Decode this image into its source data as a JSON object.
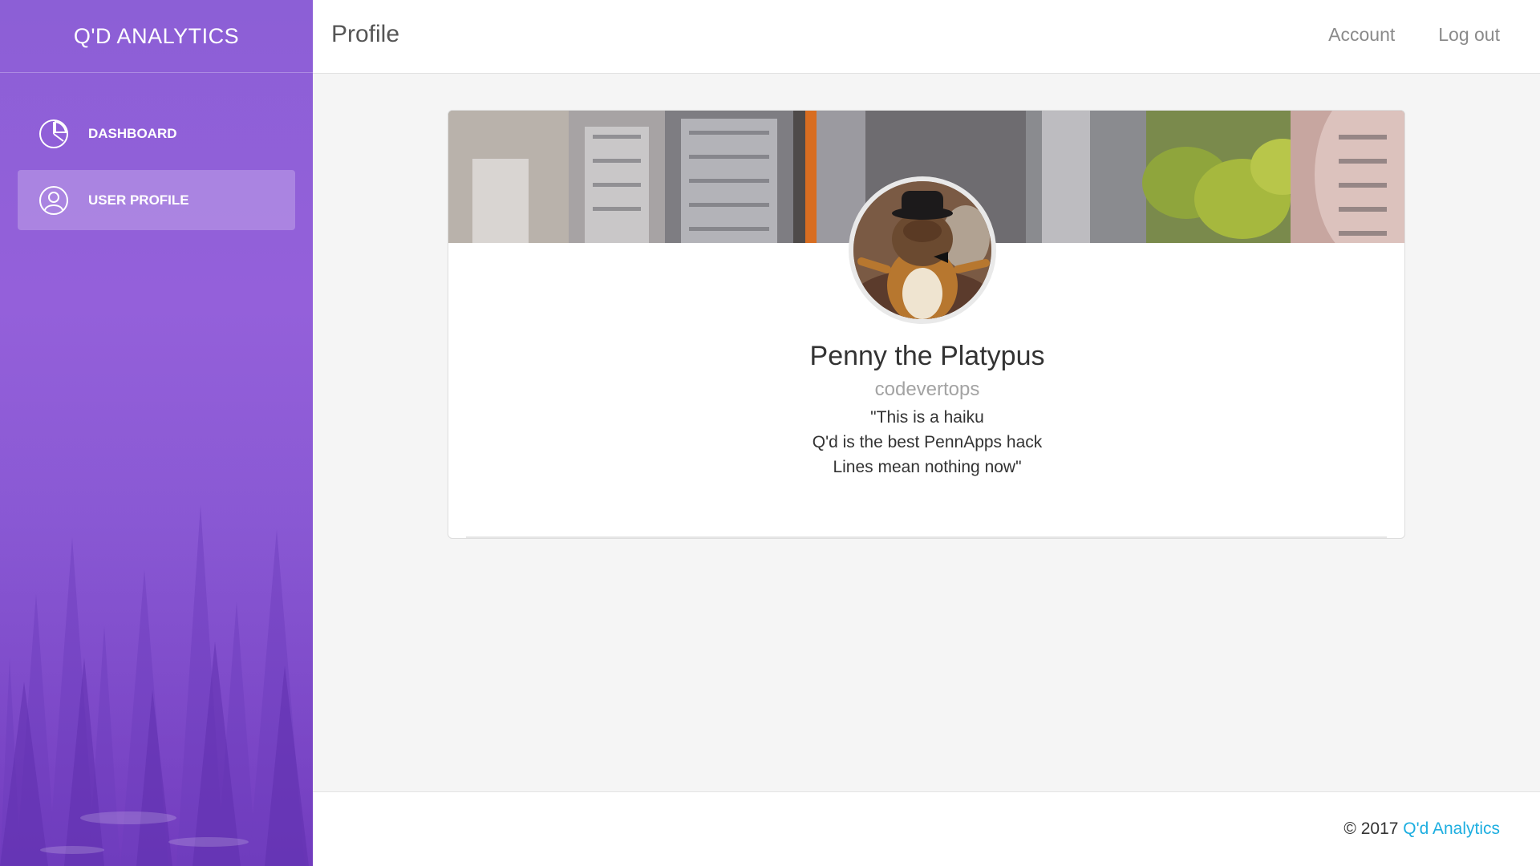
{
  "sidebar": {
    "brand": "Q'D ANALYTICS",
    "items": [
      {
        "label": "DASHBOARD",
        "icon": "pie-chart-icon",
        "active": false
      },
      {
        "label": "USER PROFILE",
        "icon": "user-icon",
        "active": true
      }
    ]
  },
  "header": {
    "title": "Profile",
    "links": [
      "Account",
      "Log out"
    ]
  },
  "profile": {
    "name": "Penny the Platypus",
    "username": "codevertops",
    "quote_lines": [
      "\"This is a haiku",
      "Q'd is the best PennApps hack",
      "Lines mean nothing now\""
    ]
  },
  "footer": {
    "copyright_prefix": "© 2017 ",
    "link_label": "Q'd Analytics"
  },
  "colors": {
    "sidebar_purple": "#8c5fd6",
    "link_blue": "#1daee0",
    "page_bg": "#f5f5f5"
  }
}
